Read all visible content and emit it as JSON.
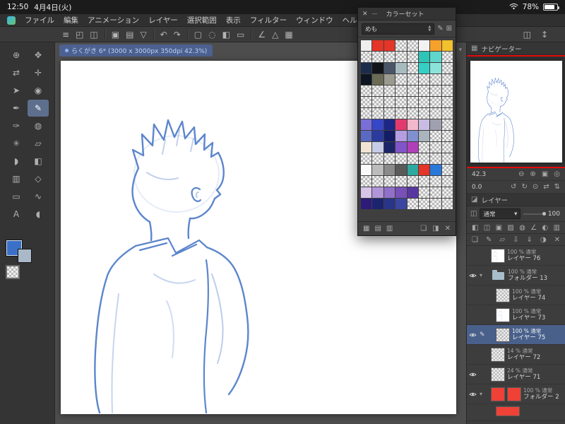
{
  "status_bar": {
    "time": "12:50",
    "date": "4月4日(火)",
    "battery_percent": "78%"
  },
  "menu_bar": {
    "items": [
      "ファイル",
      "編集",
      "アニメーション",
      "レイヤー",
      "選択範囲",
      "表示",
      "フィルター",
      "ウィンドウ",
      "ヘルプ"
    ]
  },
  "command_bar": {
    "icons": [
      {
        "name": "main-menu-icon",
        "glyph": "≡"
      },
      {
        "name": "edit-canvas-icon",
        "glyph": "◰"
      },
      {
        "name": "tool-property-icon",
        "glyph": "◫"
      },
      {
        "divider": true
      },
      {
        "name": "new-canvas-icon",
        "glyph": "▣"
      },
      {
        "name": "open-file-icon",
        "glyph": "▤"
      },
      {
        "name": "save-file-icon",
        "glyph": "▽"
      },
      {
        "divider": true
      },
      {
        "name": "undo-icon",
        "glyph": "↶"
      },
      {
        "name": "redo-icon",
        "glyph": "↷"
      },
      {
        "divider": true
      },
      {
        "name": "select-rectangle-icon",
        "glyph": "▢"
      },
      {
        "name": "deselect-icon",
        "glyph": "◌"
      },
      {
        "name": "fill-icon",
        "glyph": "◧"
      },
      {
        "name": "crop-icon",
        "glyph": "▭"
      },
      {
        "divider": true
      },
      {
        "name": "snap-ruler-icon",
        "glyph": "∠"
      },
      {
        "name": "snap-special-ruler-icon",
        "glyph": "△"
      },
      {
        "name": "grid-icon",
        "glyph": "▦"
      }
    ],
    "right_icons": [
      {
        "name": "panel-layout-icon",
        "glyph": "◫"
      },
      {
        "name": "expand-panel-icon",
        "glyph": "↕"
      }
    ]
  },
  "document_tab": {
    "label": "らくがき 6* (3000 x 3000px 350dpi 42.3%)",
    "overflow_glyph": "▾"
  },
  "toolbar": {
    "tools": [
      {
        "name": "zoom-tool",
        "glyph": "⊕",
        "selected": false
      },
      {
        "name": "move-canvas-tool",
        "glyph": "✥",
        "selected": false
      },
      {
        "name": "flip-view-tool",
        "glyph": "⇄",
        "selected": false
      },
      {
        "name": "move-tool",
        "glyph": "✛",
        "selected": false
      },
      {
        "name": "operation-tool",
        "glyph": "➤",
        "selected": false
      },
      {
        "name": "eyedropper-tool",
        "glyph": "◉",
        "selected": false
      },
      {
        "name": "pen-tool",
        "glyph": "✒",
        "selected": false
      },
      {
        "name": "pencil-tool",
        "glyph": "✎",
        "selected": true
      },
      {
        "name": "brush-tool",
        "glyph": "✑",
        "selected": false
      },
      {
        "name": "airbrush-tool",
        "glyph": "◍",
        "selected": false
      },
      {
        "name": "decoration-tool",
        "glyph": "✳",
        "selected": false
      },
      {
        "name": "eraser-tool",
        "glyph": "▱",
        "selected": false
      },
      {
        "name": "blend-tool",
        "glyph": "◗",
        "selected": false
      },
      {
        "name": "fill-tool",
        "glyph": "◧",
        "selected": false
      },
      {
        "name": "gradient-tool",
        "glyph": "▥",
        "selected": false
      },
      {
        "name": "figure-tool",
        "glyph": "◇",
        "selected": false
      },
      {
        "name": "frame-border-tool",
        "glyph": "▭",
        "selected": false
      },
      {
        "name": "correct-line-tool",
        "glyph": "∿",
        "selected": false
      },
      {
        "name": "text-tool",
        "glyph": "A",
        "selected": false
      },
      {
        "name": "balloon-tool",
        "glyph": "◖",
        "selected": false
      }
    ],
    "primary_color": "#3a70c8",
    "secondary_color": "#a9b9c9"
  },
  "color_set": {
    "close_glyph": "✕",
    "minimize_glyph": "—",
    "title": "カラーセット",
    "preset": "めも",
    "edit_glyph": "✎",
    "add_set_glyph": "⊞",
    "rows": [
      [
        "#efefef",
        "#e53528",
        "#e53528",
        null,
        null,
        "#f2f2f2",
        "#f6a12b",
        "#f2c12e"
      ],
      [
        null,
        null,
        null,
        null,
        null,
        "#2ec4b6",
        "#5fd6cc",
        null
      ],
      [
        "#1b2b4b",
        "#111418",
        "#4a5668",
        "#a8bcc0",
        null,
        "#35cfc4",
        "#8ce3da",
        null
      ],
      [
        "#0d1520",
        "#6a6a55",
        "#9a9a90",
        null,
        null,
        null,
        null,
        null
      ],
      [
        null,
        null,
        null,
        null,
        null,
        null,
        null,
        null
      ],
      [
        null,
        null,
        null,
        null,
        null,
        null,
        null,
        null
      ],
      [
        null,
        null,
        null,
        null,
        null,
        null,
        null,
        null
      ],
      [
        "#7a6fd8",
        "#3646c8",
        "#1d2788",
        "#e23a6e",
        "#f2b8cc",
        "#c8bce4",
        "#a0a0b0",
        null
      ],
      [
        "#5a6ac4",
        "#2b3a9e",
        "#141c66",
        "#b49de0",
        "#8090d0",
        "#aab4be",
        null,
        null
      ],
      [
        "#f2e4d4",
        "#c4cce8",
        "#1c2468",
        "#8055c8",
        "#b040b8",
        null,
        null,
        null
      ],
      [
        null,
        null,
        null,
        null,
        null,
        null,
        null,
        null
      ],
      [
        "#fafafa",
        "#bcbcbc",
        "#8a8a8a",
        "#5a5a5a",
        "#2fa8a0",
        "#e53528",
        "#2a78d8",
        null
      ],
      [
        null,
        null,
        null,
        null,
        null,
        null,
        null,
        null
      ],
      [
        "#d8c4e8",
        "#b095d8",
        "#9070c8",
        "#7850b8",
        "#5838a0",
        null,
        null,
        null
      ],
      [
        "#2e1a78",
        "#1c2470",
        "#2a3488",
        "#3a46a0",
        null,
        null,
        null,
        null
      ]
    ],
    "footer_left": [
      {
        "name": "small-swatch-view-icon",
        "glyph": "▦"
      },
      {
        "name": "medium-swatch-view-icon",
        "glyph": "▤"
      },
      {
        "name": "list-view-icon",
        "glyph": "▥"
      }
    ],
    "footer_right": [
      {
        "name": "add-color-icon",
        "glyph": "❏"
      },
      {
        "name": "replace-color-icon",
        "glyph": "◨"
      },
      {
        "name": "delete-color-icon",
        "glyph": "✕"
      }
    ]
  },
  "navigator": {
    "panel_icon_glyph": "▦",
    "title": "ナビゲーター",
    "zoom_value": "42.3",
    "rotate_value": "0.0",
    "zoom_icons": [
      {
        "name": "zoom-out-icon",
        "glyph": "⊖"
      },
      {
        "name": "zoom-in-icon",
        "glyph": "⊕"
      },
      {
        "name": "fit-to-screen-icon",
        "glyph": "▣"
      },
      {
        "name": "actual-pixels-icon",
        "glyph": "◎"
      }
    ],
    "rotate_icons": [
      {
        "name": "rotate-left-icon",
        "glyph": "↺"
      },
      {
        "name": "rotate-right-icon",
        "glyph": "↻"
      },
      {
        "name": "reset-rotate-icon",
        "glyph": "⊙"
      },
      {
        "name": "flip-horizontal-icon",
        "glyph": "⇄"
      },
      {
        "name": "flip-vertical-icon",
        "glyph": "⇅"
      }
    ]
  },
  "layer_panel": {
    "panel_icon_glyph": "◪",
    "title": "レイヤー",
    "blend_mode": "通常",
    "blend_caret": "▾",
    "opacity": "100",
    "controls_row1": [
      {
        "name": "change-palette-icon",
        "glyph": "◧"
      },
      {
        "name": "combine-mode-icon",
        "glyph": "◫"
      },
      {
        "name": "lock-layer-icon",
        "glyph": "▣"
      },
      {
        "name": "lock-transparent-pixels-icon",
        "glyph": "▨"
      },
      {
        "name": "enable-mask-icon",
        "glyph": "◍"
      },
      {
        "name": "set-ruler-icon",
        "glyph": "∠"
      },
      {
        "name": "layer-color-icon",
        "glyph": "◐"
      },
      {
        "name": "two-pane-view-icon",
        "glyph": "▥"
      }
    ],
    "controls_row2": [
      {
        "name": "new-raster-layer-icon",
        "glyph": "❏"
      },
      {
        "name": "new-vector-layer-icon",
        "glyph": "✎"
      },
      {
        "name": "new-folder-icon",
        "glyph": "▱"
      },
      {
        "name": "transfer-to-lower-icon",
        "glyph": "⇩"
      },
      {
        "name": "merge-to-lower-icon",
        "glyph": "⇓"
      },
      {
        "name": "layer-mask-icon",
        "glyph": "◑"
      },
      {
        "name": "delete-layer-icon",
        "glyph": "✕"
      }
    ],
    "layers": [
      {
        "opacity": "100 %",
        "mode": "通常",
        "name": "レイヤー 76",
        "type": "sketch",
        "visible": false,
        "selected": false,
        "editing": false,
        "indent": 0,
        "partial": false
      },
      {
        "opacity": "100 %",
        "mode": "通常",
        "name": "フォルダー 13",
        "type": "folder",
        "visible": true,
        "selected": false,
        "editing": false,
        "indent": 0,
        "partial": false
      },
      {
        "opacity": "100 %",
        "mode": "通常",
        "name": "レイヤー 74",
        "type": "checker",
        "visible": false,
        "selected": false,
        "editing": false,
        "indent": 1,
        "partial": false
      },
      {
        "opacity": "100 %",
        "mode": "通常",
        "name": "レイヤー 73",
        "type": "sketch",
        "visible": false,
        "selected": false,
        "editing": false,
        "indent": 1,
        "partial": false
      },
      {
        "opacity": "100 %",
        "mode": "通常",
        "name": "レイヤー 75",
        "type": "sketch-checker",
        "visible": true,
        "selected": true,
        "editing": true,
        "indent": 1,
        "partial": false
      },
      {
        "opacity": "14 %",
        "mode": "通常",
        "name": "レイヤー 72",
        "type": "checker",
        "visible": false,
        "selected": false,
        "editing": false,
        "indent": 0,
        "partial": false
      },
      {
        "opacity": "24 %",
        "mode": "通常",
        "name": "レイヤー 71",
        "type": "checker",
        "visible": true,
        "selected": false,
        "editing": false,
        "indent": 0,
        "partial": false
      },
      {
        "opacity": "100 %",
        "mode": "通常",
        "name": "フォルダー 2",
        "type": "red-pair",
        "visible": true,
        "selected": false,
        "editing": false,
        "indent": 0,
        "partial": false
      },
      {
        "opacity": "",
        "mode": "",
        "name": "",
        "type": "red-wide",
        "visible": false,
        "selected": false,
        "editing": false,
        "indent": 1,
        "partial": true
      }
    ]
  }
}
